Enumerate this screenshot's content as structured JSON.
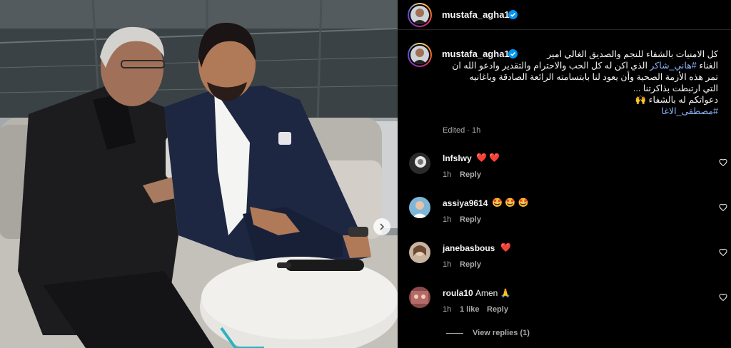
{
  "post": {
    "username": "mustafa_agha1",
    "caption_lines": [
      "كل الامنيات بالشفاء للنجم والصديق الغالي امير",
      "الغناء ",
      "#هاني_شاكر",
      " الذي اكن له كل الحب والاحترام والتقدير وادعو الله ان",
      "تمر هذه الأزمة الصحية وأن يعود لنا بابتسامته الرائعة الصادقة وباغانيه",
      "التي ارتبطت بذاكرتنا ...",
      "دعواتكم له بالشفاء 🙌",
      "#مصطفى_الاغا"
    ],
    "edited": "Edited",
    "time": "1h"
  },
  "comments": [
    {
      "username": "lnfslwy",
      "text": "❤️ ❤️",
      "time": "1h",
      "reply": "Reply",
      "likes": ""
    },
    {
      "username": "assiya9614",
      "text": "🤩 🤩 🤩",
      "time": "1h",
      "reply": "Reply",
      "likes": ""
    },
    {
      "username": "janebasbous",
      "text": "❤️",
      "time": "1h",
      "reply": "Reply",
      "likes": ""
    },
    {
      "username": "roula10",
      "text": "Amen 🙏",
      "time": "1h",
      "reply": "Reply",
      "likes": "1 like"
    }
  ],
  "view_replies": "View replies (1)",
  "separator": "·",
  "colors": {
    "background": "#000000",
    "text": "#f5f5f5",
    "secondary": "#a8a8a8",
    "link": "#8ab4f8",
    "verified": "#0095f6",
    "heart": "#ff3040"
  },
  "icons": {
    "verified": "verified-badge-icon",
    "heart": "heart-outline-icon",
    "next": "chevron-right-icon"
  }
}
